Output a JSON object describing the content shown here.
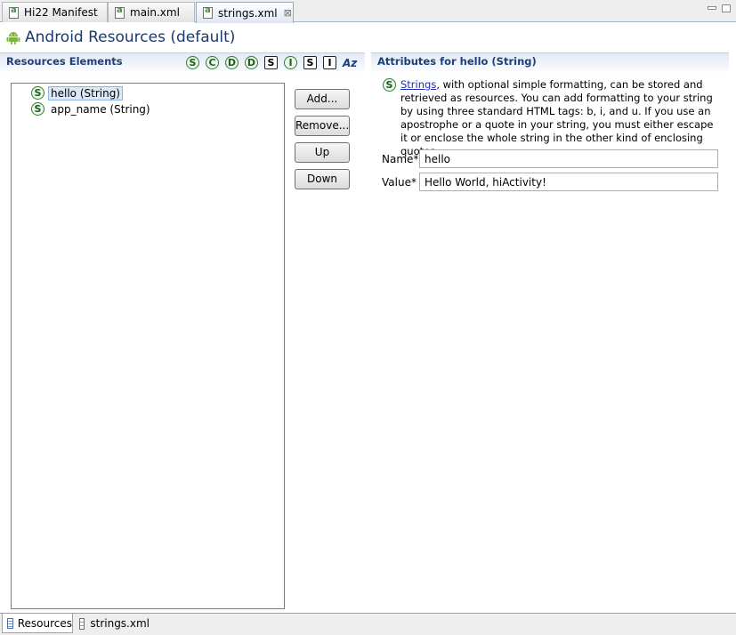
{
  "editor_tabs": [
    {
      "label": "Hi22 Manifest",
      "active": false
    },
    {
      "label": "main.xml",
      "active": false
    },
    {
      "label": "strings.xml",
      "active": true,
      "close": "⊠"
    }
  ],
  "header": {
    "title": "Android Resources (default)",
    "icon": "android-icon"
  },
  "left": {
    "heading": "Resources Elements",
    "toolbar": [
      {
        "glyph": "S",
        "shape": "circle",
        "icon": "add-string-icon"
      },
      {
        "glyph": "C",
        "shape": "circle",
        "icon": "add-color-icon"
      },
      {
        "glyph": "D",
        "shape": "circle",
        "icon": "add-dimension-icon"
      },
      {
        "glyph": "D",
        "shape": "circle",
        "icon": "add-drawable-icon"
      },
      {
        "glyph": "S",
        "shape": "square",
        "icon": "add-style-icon"
      },
      {
        "glyph": "I",
        "shape": "circle",
        "icon": "add-item-icon"
      },
      {
        "glyph": "S",
        "shape": "square",
        "icon": "add-string-array-icon"
      },
      {
        "glyph": "I",
        "shape": "square",
        "icon": "add-integer-array-icon"
      },
      {
        "glyph": "Az",
        "shape": "text",
        "icon": "sort-alphabetically-icon"
      }
    ],
    "tree": [
      {
        "icon": "S",
        "label": "hello (String)",
        "selected": true
      },
      {
        "icon": "S",
        "label": "app_name (String)",
        "selected": false
      }
    ],
    "buttons": {
      "add": "Add...",
      "remove": "Remove...",
      "up": "Up",
      "down": "Down"
    }
  },
  "right": {
    "heading": "Attributes for hello (String)",
    "description_link": "Strings",
    "description_rest": ", with optional simple formatting, can be stored and retrieved as resources. You can add formatting to your string by using three standard HTML tags: b, i, and u. If you use an apostrophe or a quote in your string, you must either escape it or enclose the whole string in the other kind of enclosing quotes.",
    "fields": [
      {
        "label": "Name*",
        "value": "hello"
      },
      {
        "label": "Value*",
        "value": "Hello World, hiActivity!"
      }
    ]
  },
  "bottom_tabs": [
    {
      "label": "Resources",
      "active": true
    },
    {
      "label": "strings.xml",
      "active": false
    }
  ],
  "colors": {
    "accent": "#1f3f7a",
    "string_icon": "#2f7d2f",
    "selection": "#dbe8f8"
  }
}
